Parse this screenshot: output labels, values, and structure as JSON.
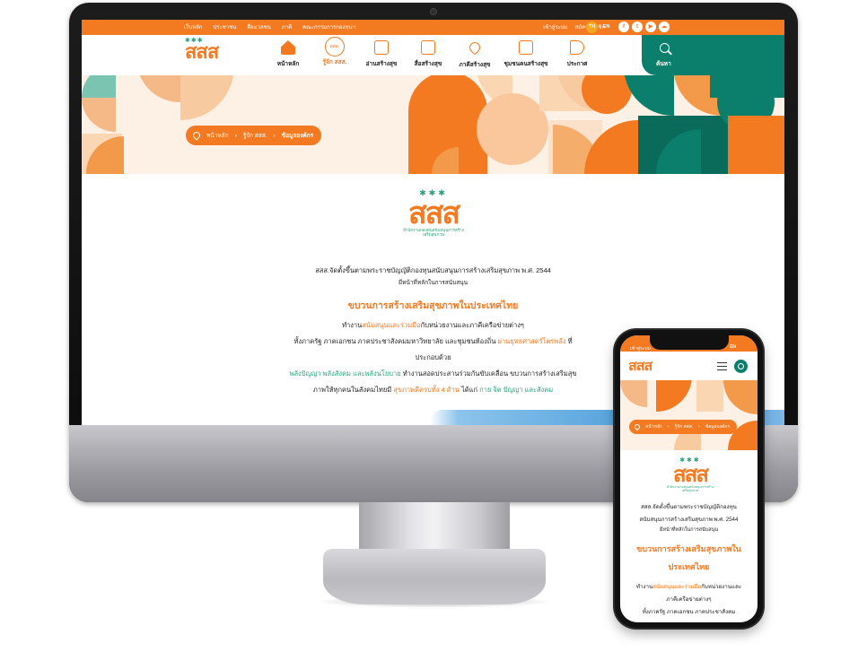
{
  "desktop": {
    "topbar": {
      "links": [
        "เว็บหลัก",
        "ประชาชน",
        "สื่อมวลชน",
        "ภาคี",
        "คณะกรรมการกองทุนฯ"
      ],
      "login": "เข้าสู่ระบบ",
      "register": "สมัครสมาชิก",
      "lang_th": "TH",
      "lang_en": "EN",
      "socials": [
        "facebook-icon",
        "twitter-icon",
        "youtube-icon",
        "line-icon"
      ]
    },
    "nav": {
      "logo": "สสส",
      "items": [
        "หน้าหลัก",
        "รู้จัก สสส.",
        "อ่านสร้างสุข",
        "สื่อสร้างสุข",
        "ภาคีสร้างสุข",
        "ชุมชนคนสร้างสุข",
        "ประกาศ"
      ],
      "search_label": "ค้นหา"
    },
    "breadcrumb": [
      "หน้าหลัก",
      "รู้จัก สสส.",
      "ข้อมูลองค์กร"
    ],
    "content": {
      "logo_mark": "สสส",
      "logo_sub": "สำนักงานกองทุนสนับสนุนการสร้างเสริมสุขภาพ",
      "line1": "สสส.จัดตั้งขึ้นตามพระราชบัญญัติกองทุนสนับสนุนการสร้างเสริมสุขภาพ พ.ศ. 2544",
      "line2": "มีหน้าที่หลักในการสนับสนุน",
      "heading": "ขบวนการสร้างเสริมสุขภาพในประเทศไทย",
      "p1_pre": "ทำงาน",
      "p1_hl": "สนับสนุนและร่วมมือ",
      "p1_post": "กับหน่วยงานและภาคีเครือข่ายต่างๆ",
      "p2_pre": "ทั้งภาครัฐ ภาคเอกชน ภาคประชาสังคมมหาวิทยาลัย และชุมชนท้องถิ่น ",
      "p2_hl": "ผ่านยุทธศาสตร์ไตรพลัง",
      "p2_post": " ที่",
      "p3": "ประกอบด้วย",
      "p4_gr": "พลังปัญญา พลังสังคม และพลังนโยบาย",
      "p4_post": " ทำงานสอดประสานร่วมกันขับเคลื่อน ขบวนการสร้างเสริมสุข",
      "p5_pre": "ภาพให้ทุกคนในสังคมไทยมี ",
      "p5_hl": "สุขภาพดีครบทั้ง 4 ด้าน",
      "p5_mid": " ได้แก่ ",
      "p5_gr": "กาย จิต ปัญญา และสังคม"
    }
  },
  "mobile": {
    "topbar": {
      "login": "เข้าสู่ระบบ",
      "lang": "EN"
    },
    "logo": "สสส",
    "breadcrumb": [
      "หน้าหลัก",
      "รู้จัก สสส.",
      "ข้อมูลองค์กร"
    ],
    "content": {
      "logo_mark": "สสส",
      "logo_sub": "สำนักงานกองทุนสนับสนุนการสร้างเสริมสุขภาพ",
      "line1": "สสส.จัดตั้งขึ้นตามพระราชบัญญัติกองทุน",
      "line2": "สนับสนุนการสร้างเสริมสุขภาพ พ.ศ. 2544",
      "line3": "มีหน้าที่หลักในการสนับสนุน",
      "heading1": "ขบวนการสร้างเสริมสุขภาพใน",
      "heading2": "ประเทศไทย",
      "p1_pre": "ทำงาน",
      "p1_hl": "สนับสนุนและร่วมมือ",
      "p1_post": "กับหน่วยงานและ",
      "p2": "ภาคีเครือข่ายต่างๆ",
      "p3": "ทั้งภาครัฐ ภาคเอกชน ภาคประชาสังคม"
    }
  },
  "colors": {
    "brand_orange": "#f37a21",
    "brand_green": "#0b7f6b",
    "accent_green": "#27a17a",
    "hero_bg": "#fdf0e4"
  }
}
